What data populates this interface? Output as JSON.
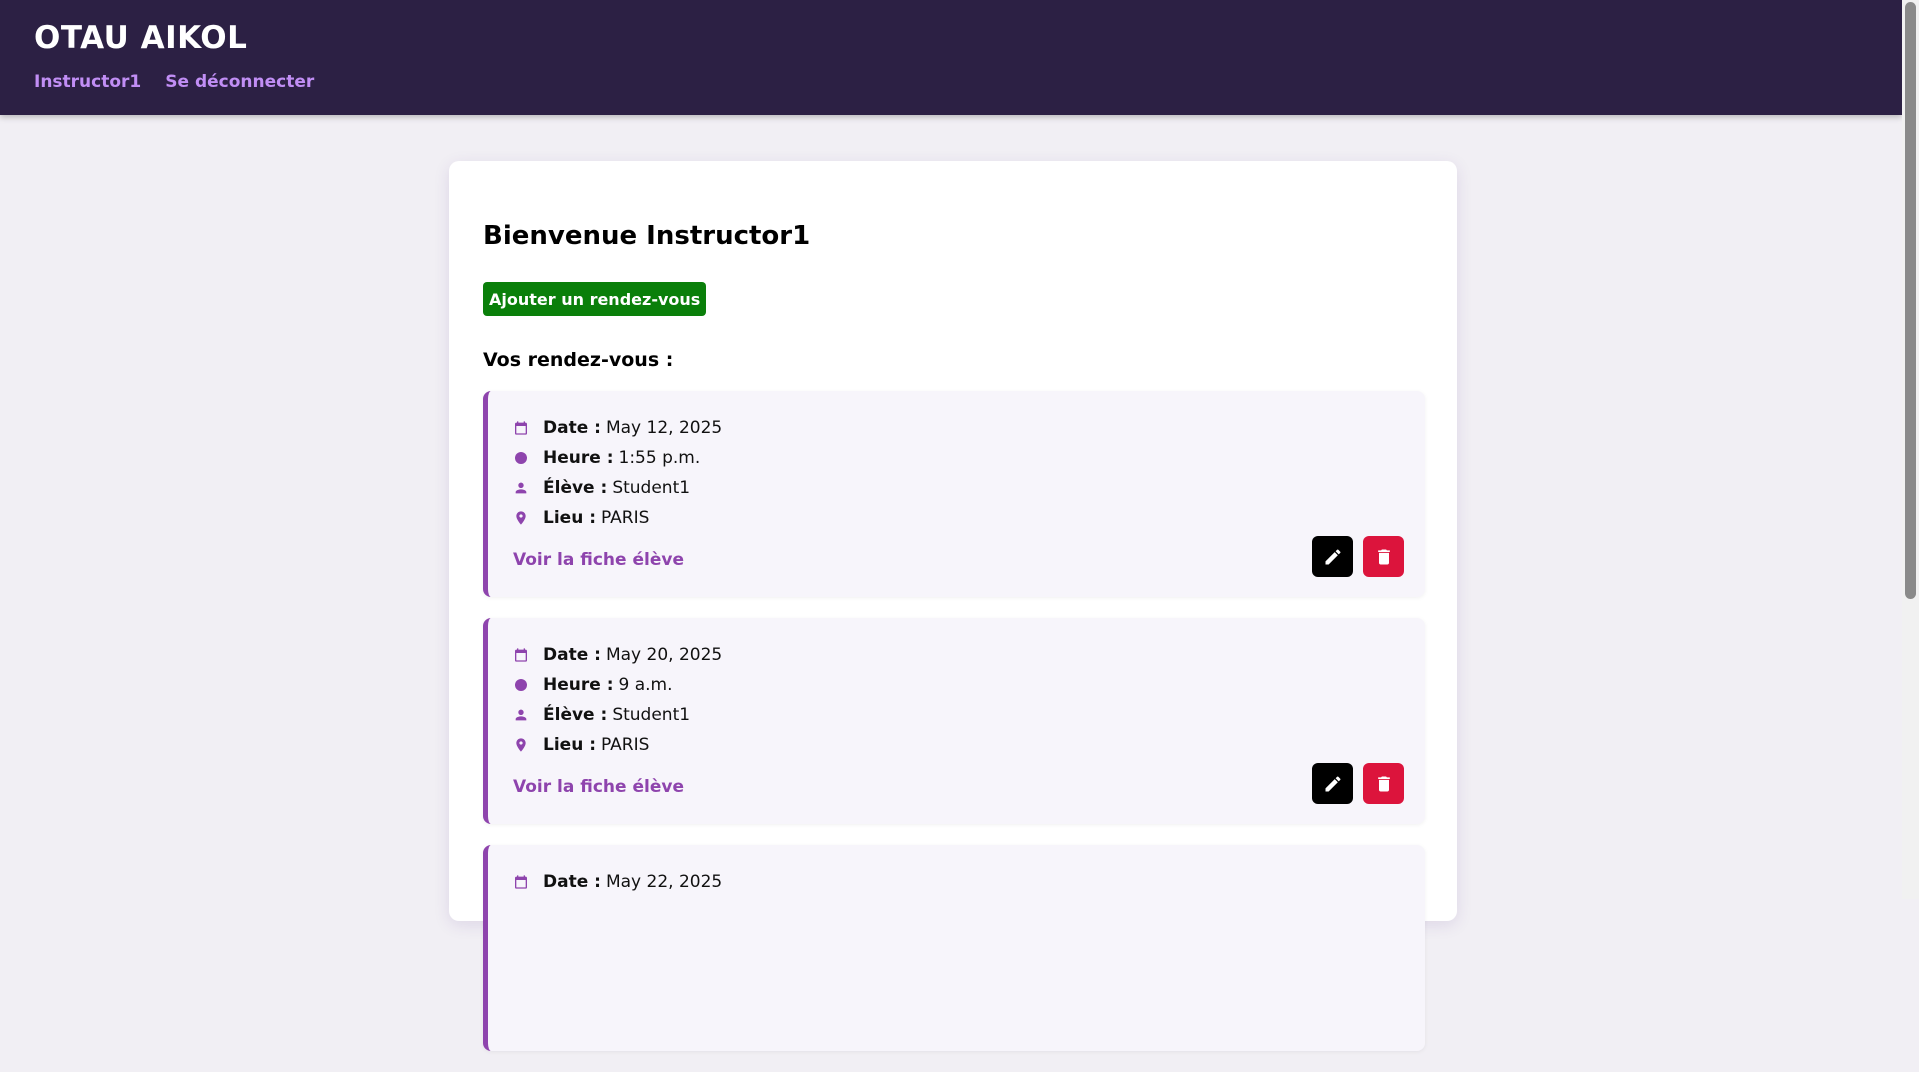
{
  "header": {
    "brand": "OTAU AIKOL",
    "nav": [
      {
        "label": "Instructor1"
      },
      {
        "label": "Se déconnecter"
      }
    ]
  },
  "main": {
    "welcome": "Bienvenue Instructor1",
    "add_button": "Ajouter un rendez-vous",
    "section_title": "Vos rendez-vous :",
    "labels": {
      "date": "Date :",
      "time": "Heure :",
      "student": "Élève :",
      "place": "Lieu :"
    },
    "link_label": "Voir la fiche élève",
    "appointments": [
      {
        "date": "May 12, 2025",
        "time": "1:55 p.m.",
        "student": "Student1",
        "place": "PARIS"
      },
      {
        "date": "May 20, 2025",
        "time": "9 a.m.",
        "student": "Student1",
        "place": "PARIS"
      },
      {
        "date": "May 22, 2025",
        "time": "",
        "student": "",
        "place": ""
      }
    ]
  },
  "colors": {
    "header_bg": "#2c2044",
    "nav_link": "#c18ef5",
    "accent": "#8e44ad",
    "add_button": "#0a7f0a",
    "edit_button": "#000000",
    "delete_button": "#dc143c",
    "page_bg": "#f1eff4"
  },
  "icons": {
    "date": "calendar-icon",
    "time": "clock-icon",
    "student": "person-icon",
    "place": "location-pin-icon",
    "edit": "pencil-icon",
    "delete": "trash-icon"
  }
}
